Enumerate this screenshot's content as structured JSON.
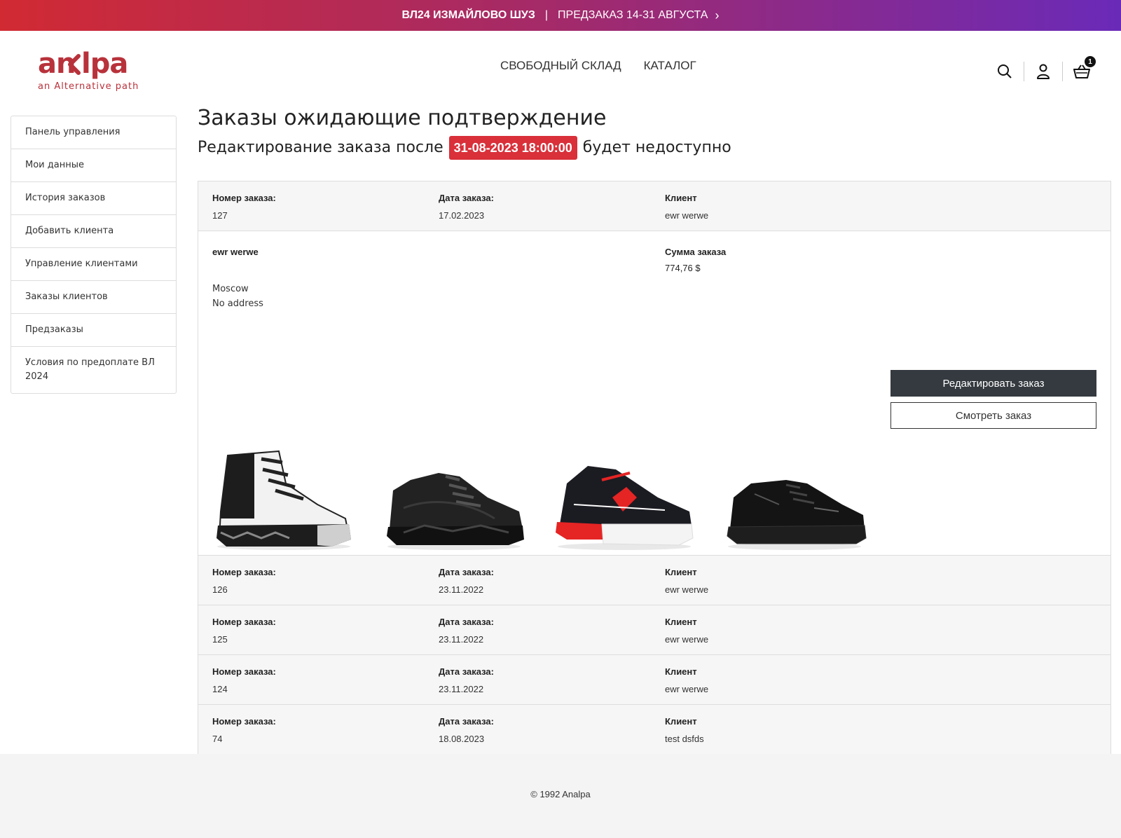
{
  "promo": {
    "bold": "ВЛ24 ИЗМАЙЛОВО ШУЗ",
    "separator": "|",
    "text": "ПРЕДЗАКАЗ 14-31 АВГУСТА",
    "chevron": "›"
  },
  "logo": {
    "word": "analpa",
    "tagline": "an Alternative path",
    "color": "#b8323b"
  },
  "nav": [
    "СВОБОДНЫЙ СКЛАД",
    "КАТАЛОГ"
  ],
  "cart": {
    "count": "1"
  },
  "sidebar": [
    "Панель управления",
    "Мои данные",
    "История заказов",
    "Добавить клиента",
    "Управление клиентами",
    "Заказы клиентов",
    "Предзаказы",
    "Условия по предоплате ВЛ 2024"
  ],
  "main": {
    "title": "Заказы ожидающие подтверждение",
    "subtitle_before": "Редактирование заказа после",
    "deadline": "31-08-2023 18:00:00",
    "subtitle_after": "будет недоступно"
  },
  "labels": {
    "order_no": "Номер заказа:",
    "date": "Дата заказа:",
    "client": "Клиент",
    "sum": "Сумма заказа"
  },
  "orders": [
    {
      "no": "127",
      "date": "17.02.2023",
      "client": "ewr werwe"
    },
    {
      "no": "126",
      "date": "23.11.2022",
      "client": "ewr werwe"
    },
    {
      "no": "125",
      "date": "23.11.2022",
      "client": "ewr werwe"
    },
    {
      "no": "124",
      "date": "23.11.2022",
      "client": "ewr werwe"
    },
    {
      "no": "74",
      "date": "18.08.2023",
      "client": "test dsfds"
    }
  ],
  "detail": {
    "name": "ewr werwe",
    "city": "Moscow",
    "address": "No address",
    "sum": "774,76 $",
    "edit_button": "Редактировать заказ",
    "view_button": "Смотреть заказ"
  },
  "footer": {
    "copyright": "© 1992 Analpa"
  },
  "colors": {
    "accent": "#d9303a",
    "dark_button": "#353a40"
  }
}
